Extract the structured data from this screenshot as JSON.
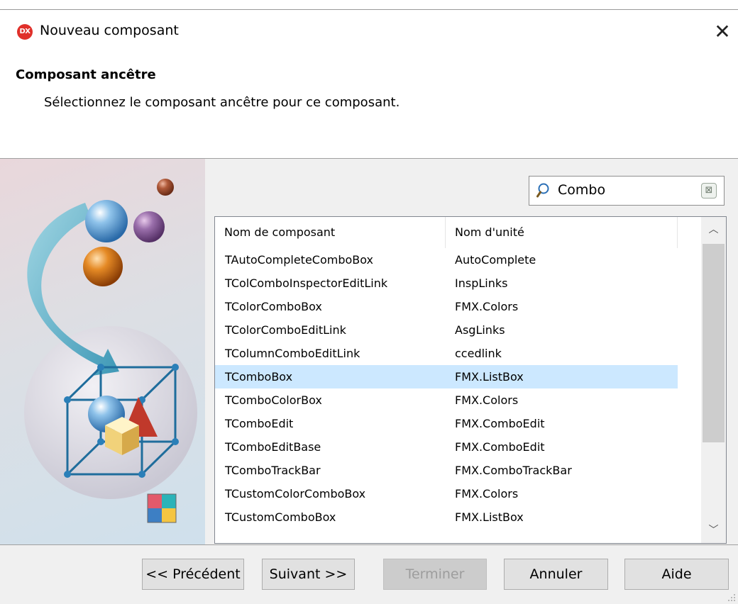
{
  "window": {
    "icon_text": "DX",
    "title": "Nouveau composant",
    "close_glyph": "✕"
  },
  "header": {
    "title": "Composant ancêtre",
    "description": "Sélectionnez le composant ancêtre pour ce composant."
  },
  "search": {
    "value": "Combo",
    "clear_glyph": "⊠",
    "icon": "search-icon"
  },
  "list": {
    "columns": [
      "Nom de composant",
      "Nom d'unité"
    ],
    "rows": [
      {
        "name": "TAutoCompleteComboBox",
        "unit": "AutoComplete"
      },
      {
        "name": "TColComboInspectorEditLink",
        "unit": "InspLinks"
      },
      {
        "name": "TColorComboBox",
        "unit": "FMX.Colors"
      },
      {
        "name": "TColorComboEditLink",
        "unit": "AsgLinks"
      },
      {
        "name": "TColumnComboEditLink",
        "unit": "ccedlink"
      },
      {
        "name": "TComboBox",
        "unit": "FMX.ListBox"
      },
      {
        "name": "TComboColorBox",
        "unit": "FMX.Colors"
      },
      {
        "name": "TComboEdit",
        "unit": "FMX.ComboEdit"
      },
      {
        "name": "TComboEditBase",
        "unit": "FMX.ComboEdit"
      },
      {
        "name": "TComboTrackBar",
        "unit": "FMX.ComboTrackBar"
      },
      {
        "name": "TCustomColorComboBox",
        "unit": "FMX.Colors"
      },
      {
        "name": "TCustomComboBox",
        "unit": "FMX.ListBox"
      }
    ],
    "selected_index": 5,
    "scroll_up_glyph": "︿",
    "scroll_down_glyph": "﹀"
  },
  "buttons": {
    "previous": "<< Précédent",
    "next": "Suivant >>",
    "finish": "Terminer",
    "cancel": "Annuler",
    "help": "Aide"
  },
  "colors": {
    "selection": "#cce8ff",
    "app_icon": "#e0302a",
    "footer_bg": "#f0f0f0"
  }
}
